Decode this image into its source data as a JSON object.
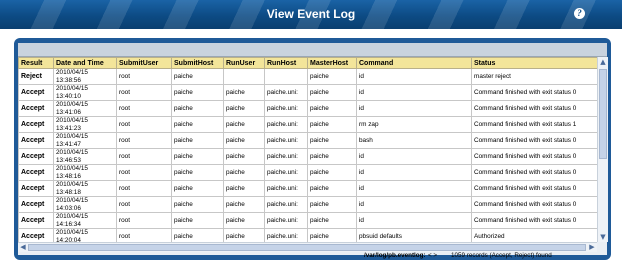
{
  "header": {
    "title": "View Event Log",
    "help_icon": "help-icon"
  },
  "table": {
    "columns": [
      "Result",
      "Date and Time",
      "SubmitUser",
      "SubmitHost",
      "RunUser",
      "RunHost",
      "MasterHost",
      "Command",
      "Status"
    ],
    "rows": [
      [
        "Reject",
        "2010/04/15",
        "13:38:56",
        "root",
        "paiche",
        "",
        "",
        "paiche",
        "id",
        "master reject"
      ],
      [
        "Accept",
        "2010/04/15",
        "13:40:10",
        "root",
        "paiche",
        "paiche",
        "paiche.uni:",
        "paiche",
        "id",
        "Command finished with exit status 0"
      ],
      [
        "Accept",
        "2010/04/15",
        "13:41:06",
        "root",
        "paiche",
        "paiche",
        "paiche.uni:",
        "paiche",
        "id",
        "Command finished with exit status 0"
      ],
      [
        "Accept",
        "2010/04/15",
        "13:41:23",
        "root",
        "paiche",
        "paiche",
        "paiche.uni:",
        "paiche",
        "rm zap",
        "Command finished with exit status 1"
      ],
      [
        "Accept",
        "2010/04/15",
        "13:41:47",
        "root",
        "paiche",
        "paiche",
        "paiche.uni:",
        "paiche",
        "bash",
        "Command finished with exit status 0"
      ],
      [
        "Accept",
        "2010/04/15",
        "13:46:53",
        "root",
        "paiche",
        "paiche",
        "paiche.uni:",
        "paiche",
        "id",
        "Command finished with exit status 0"
      ],
      [
        "Accept",
        "2010/04/15",
        "13:48:16",
        "root",
        "paiche",
        "paiche",
        "paiche.uni:",
        "paiche",
        "id",
        "Command finished with exit status 0"
      ],
      [
        "Accept",
        "2010/04/15",
        "13:48:18",
        "root",
        "paiche",
        "paiche",
        "paiche.uni:",
        "paiche",
        "id",
        "Command finished with exit status 0"
      ],
      [
        "Accept",
        "2010/04/15",
        "14:03:06",
        "root",
        "paiche",
        "paiche",
        "paiche.uni:",
        "paiche",
        "id",
        "Command finished with exit status 0"
      ],
      [
        "Accept",
        "2010/04/15",
        "14:16:34",
        "root",
        "paiche",
        "paiche",
        "paiche.uni:",
        "paiche",
        "id",
        "Command finished with exit status 0"
      ],
      [
        "Accept",
        "2010/04/15",
        "14:20:04",
        "root",
        "paiche",
        "paiche",
        "paiche.uni:",
        "paiche",
        "pbsuid defaults",
        "Authorized"
      ]
    ]
  },
  "status_bar": {
    "path": "/var/log/pb.eventlog:",
    "nav": "< >",
    "count": "1059 records (Accept, Reject) found"
  }
}
